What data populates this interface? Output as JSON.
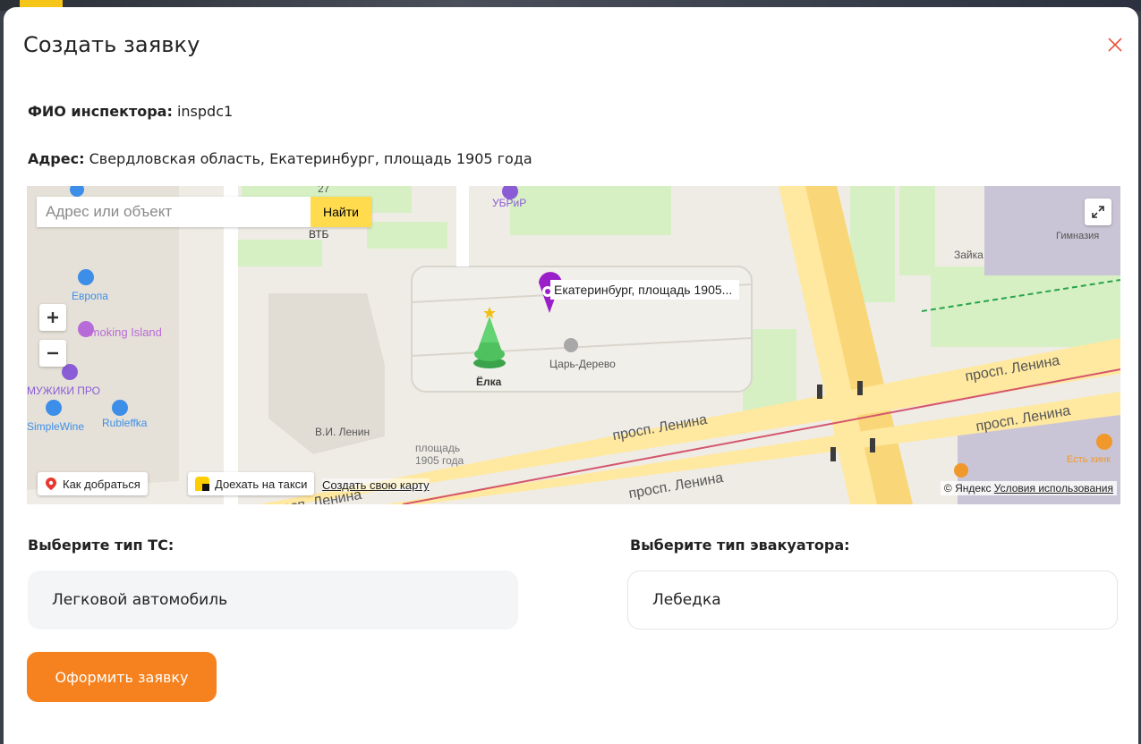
{
  "modal": {
    "title": "Создать заявку",
    "inspector_label": "ФИО инспектора:",
    "inspector_value": "inspdc1",
    "address_label": "Адрес:",
    "address_value": "Свердловская область, Екатеринбург, площадь 1905 года"
  },
  "map": {
    "search_placeholder": "Адрес или объект",
    "search_button": "Найти",
    "pin_label": "Екатеринбург, площадь 1905...",
    "route_chip": "Как добраться",
    "taxi_chip": "Доехать на такси",
    "create_map_link": "Создать свою карту",
    "copyright_text": "© Яндекс",
    "terms_link": "Условия использования",
    "labels": {
      "ubrip": "УБРиР",
      "vtb": "ВТБ",
      "num27": "27",
      "evropa": "Европа",
      "smoking_island": "Smoking Island",
      "muzhiki": "МУЖИКИ ПРО",
      "simplewine": "SimpleWine",
      "rubleffka": "Rubleffka",
      "lenin_monument": "В.И. Ленин",
      "square_line1": "площадь",
      "square_line2": "1905 года",
      "elka": "Ёлка",
      "tsar_derevo": "Царь-Дерево",
      "zaika": "Зайка",
      "gymnasium": "Гимназия",
      "lenina_1": "просп. Ленина",
      "lenina_2": "просп. Ленина",
      "lenina_3": "просп. Ленина",
      "lenina_4": "просп. Ленина",
      "lenina_5": "просп. Ленина",
      "est_hinkali": "Есть хинк"
    }
  },
  "form": {
    "vehicle_label": "Выберите тип ТС:",
    "vehicle_value": "Легковой автомобиль",
    "tow_label": "Выберите тип эвакуатора:",
    "tow_value": "Лебедка",
    "submit_label": "Оформить заявку"
  },
  "colors": {
    "accent": "#f5821f",
    "close_icon": "#e8543a",
    "map_search_button": "#ffdb4d",
    "pin": "#9b1fc9"
  }
}
